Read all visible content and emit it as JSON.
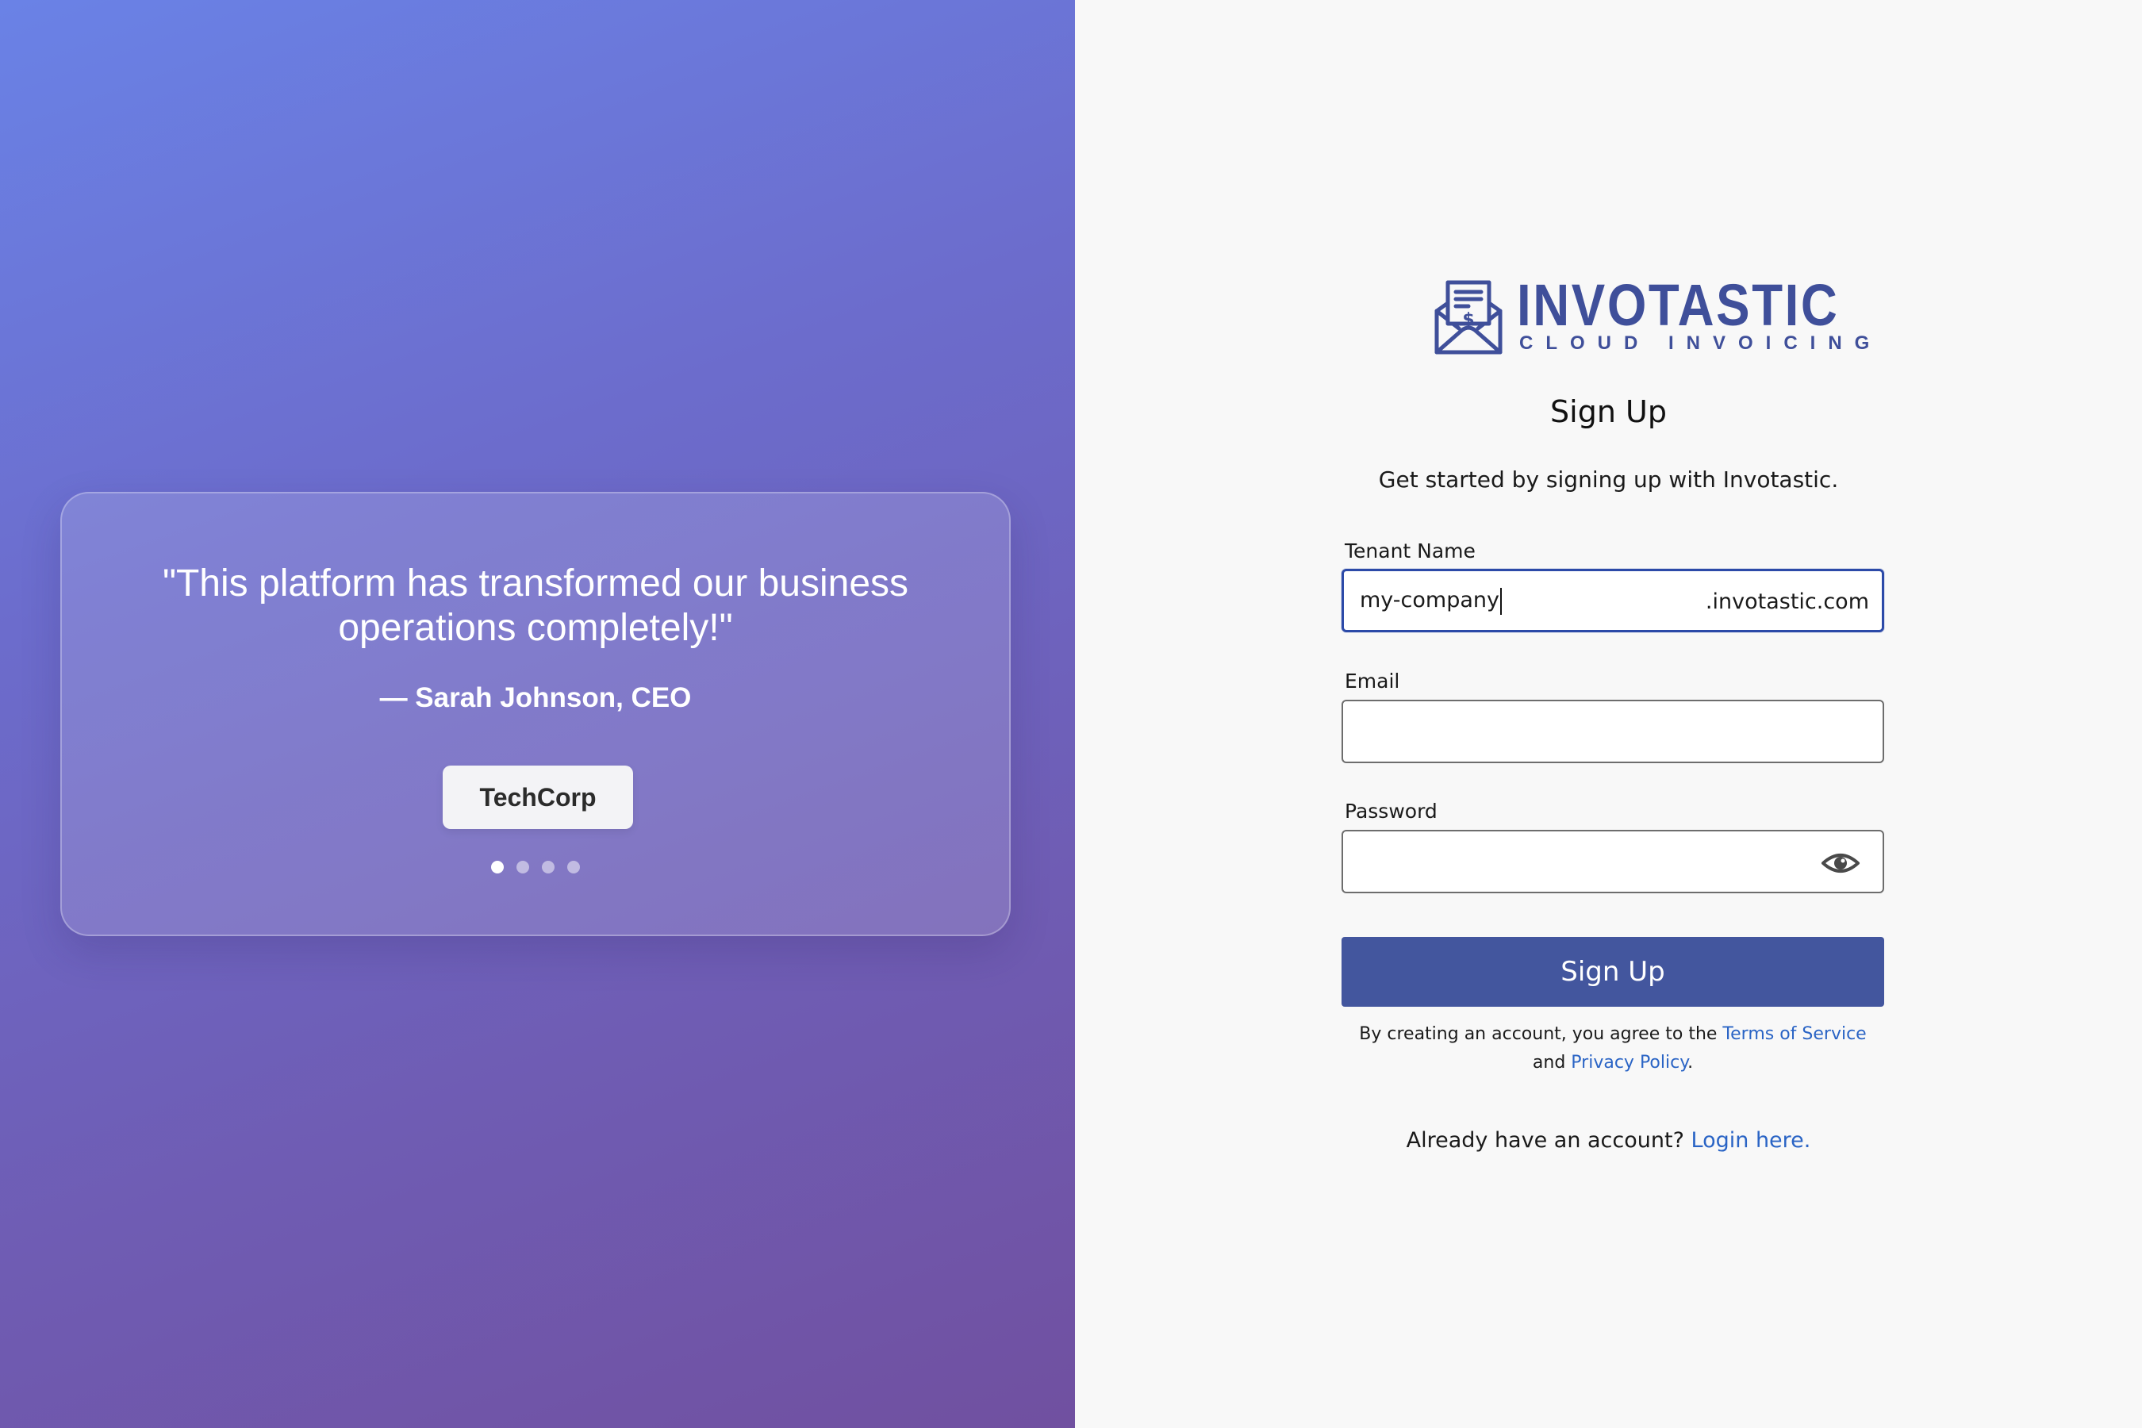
{
  "testimonial": {
    "quote": "\"This platform has transformed our business operations completely!\"",
    "author": "— Sarah Johnson, CEO",
    "company": "TechCorp",
    "slide_count": 4,
    "active_slide": 1
  },
  "brand": {
    "name": "INVOTASTIC",
    "tagline": "CLOUD INVOICING",
    "logo_icon": "envelope-invoice-icon",
    "color": "#3f4f9a"
  },
  "form": {
    "title": "Sign Up",
    "subtitle": "Get started by signing up with Invotastic.",
    "tenant": {
      "label": "Tenant Name",
      "value": "my-company",
      "suffix": ".invotastic.com"
    },
    "email": {
      "label": "Email",
      "value": ""
    },
    "password": {
      "label": "Password",
      "value": "",
      "toggle_icon": "eye-icon"
    },
    "submit_label": "Sign Up",
    "submit_color": "#43569e",
    "terms": {
      "prefix": "By creating an account, you agree to the",
      "terms_link": "Terms of Service",
      "and": "and",
      "privacy_link": "Privacy Policy",
      "suffix": "."
    },
    "login": {
      "prompt": "Already have an account?",
      "link": "Login here."
    }
  },
  "colors": {
    "link": "#2a64c5",
    "focus": "#2c4aa8"
  }
}
